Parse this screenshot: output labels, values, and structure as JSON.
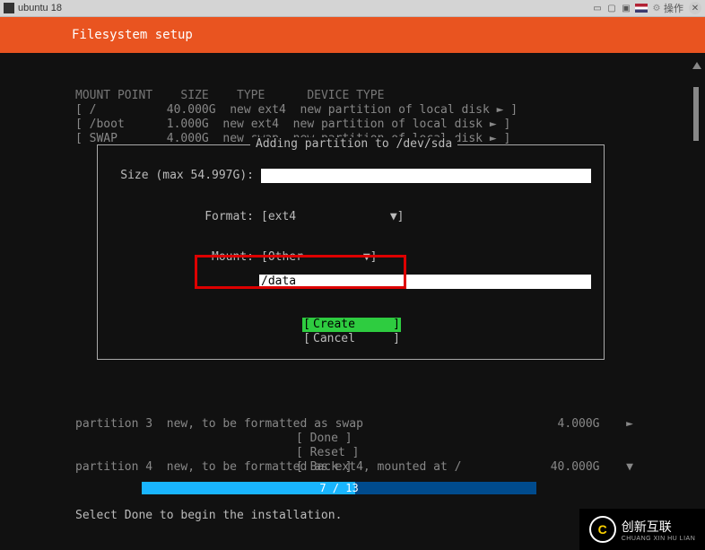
{
  "window": {
    "title": "ubuntu 18",
    "action_label": "操作"
  },
  "header": {
    "title": "Filesystem setup"
  },
  "table": {
    "cols": [
      "MOUNT POINT",
      "SIZE",
      "TYPE",
      "DEVICE TYPE"
    ],
    "rows": [
      {
        "mount": "/",
        "size": "40.000G",
        "type": "new ext4",
        "dev": "new partition of local disk"
      },
      {
        "mount": "/boot",
        "size": "1.000G",
        "type": "new ext4",
        "dev": "new partition of local disk"
      },
      {
        "mount": "SWAP",
        "size": "4.000G",
        "type": "new swap",
        "dev": "new partition of local disk"
      }
    ]
  },
  "dialog": {
    "title": "Adding partition to /dev/sda",
    "size_label": "Size (max 54.997G):",
    "size_value": "",
    "format_label": "Format:",
    "format_value": "ext4",
    "mount_label": "Mount:",
    "mount_value": "Other",
    "mount_path": "/data",
    "create": "Create",
    "cancel": "Cancel"
  },
  "lower": {
    "rows": [
      {
        "text": "partition 3  new, to be formatted as swap",
        "size": "4.000G",
        "arrow": "►"
      },
      {
        "text": "partition 4  new, to be formatted as ext4, mounted at /",
        "size": "40.000G",
        "arrow": "▼"
      }
    ],
    "nav": {
      "done": "Done",
      "reset": "Reset",
      "back": "Back"
    }
  },
  "progress": {
    "text": "7 / 13"
  },
  "hint": "Select Done to begin the installation.",
  "watermark": {
    "cn": "创新互联",
    "py": "CHUANG XIN HU LIAN",
    "logo": "C"
  }
}
